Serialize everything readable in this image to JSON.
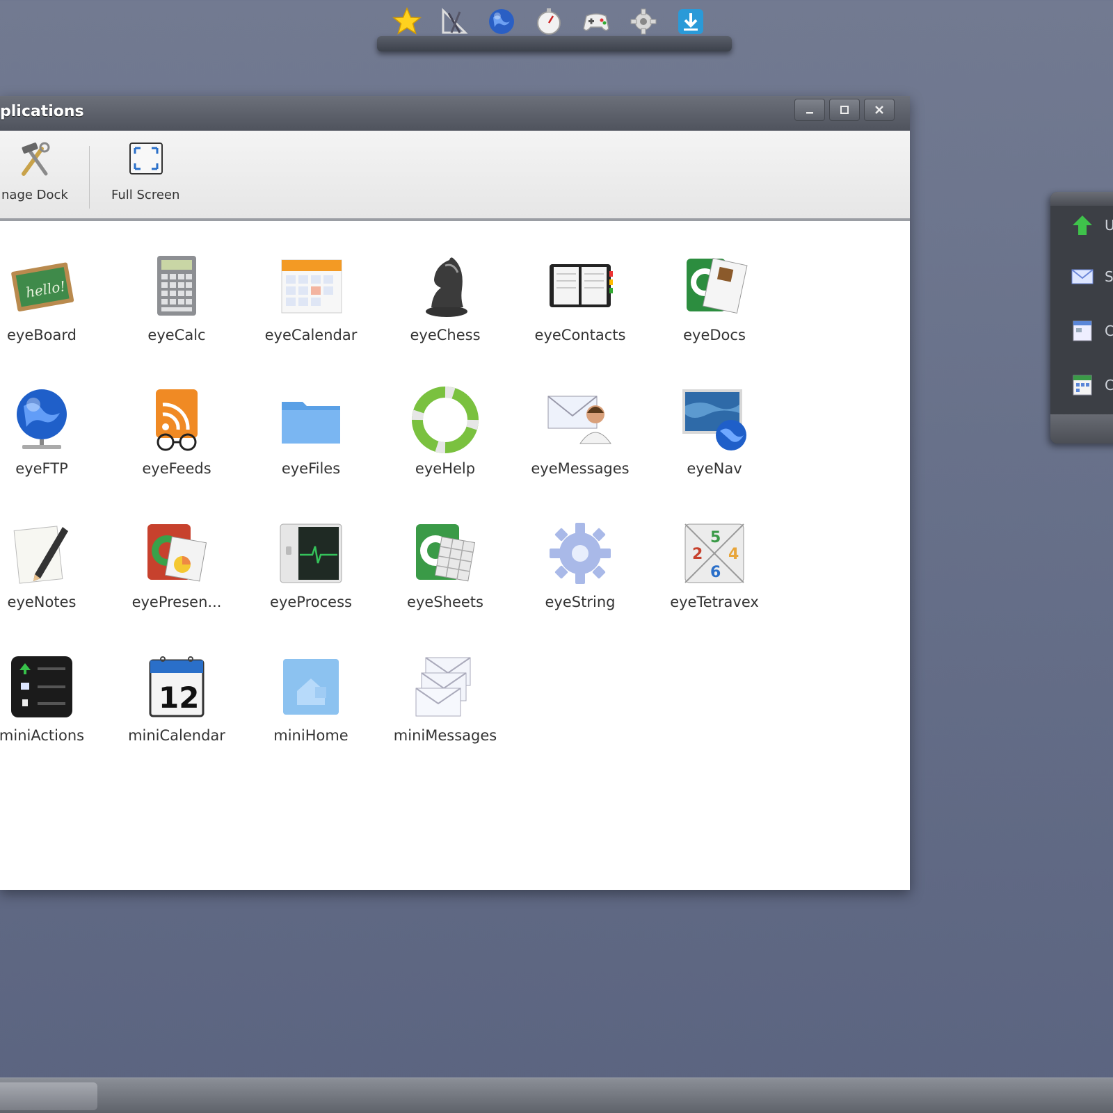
{
  "dock": {
    "icons": [
      "star-icon",
      "ruler-compass-icon",
      "globe-icon",
      "stopwatch-icon",
      "gamepad-icon",
      "gear-icon",
      "download-icon"
    ]
  },
  "window": {
    "title": "plications",
    "buttons": [
      "minimize",
      "maximize",
      "close"
    ]
  },
  "toolbar": {
    "manage_dock": "nage Dock",
    "full_screen": "Full Screen"
  },
  "apps": [
    {
      "label": "eyeBoard"
    },
    {
      "label": "eyeCalc"
    },
    {
      "label": "eyeCalendar"
    },
    {
      "label": "eyeChess"
    },
    {
      "label": "eyeContacts"
    },
    {
      "label": "eyeDocs"
    },
    {
      "label": "eyeFTP"
    },
    {
      "label": "eyeFeeds"
    },
    {
      "label": "eyeFiles"
    },
    {
      "label": "eyeHelp"
    },
    {
      "label": "eyeMessages"
    },
    {
      "label": "eyeNav"
    },
    {
      "label": "eyeNotes"
    },
    {
      "label": "eyePresen..."
    },
    {
      "label": "eyeProcess"
    },
    {
      "label": "eyeSheets"
    },
    {
      "label": "eyeString"
    },
    {
      "label": "eyeTetravex"
    },
    {
      "label": "miniActions"
    },
    {
      "label": "miniCalendar"
    },
    {
      "label": "miniHome"
    },
    {
      "label": "miniMessages"
    }
  ],
  "right_panel": {
    "items": [
      {
        "icon": "upload-arrow-icon",
        "label": "U"
      },
      {
        "icon": "mail-icon",
        "label": "S"
      },
      {
        "icon": "document-icon",
        "label": "C"
      },
      {
        "icon": "calendar-icon",
        "label": "C"
      }
    ]
  },
  "colors": {
    "desktop": "#68718a",
    "titlebar": "#4f535d",
    "toolbar": "#eeeeee"
  }
}
